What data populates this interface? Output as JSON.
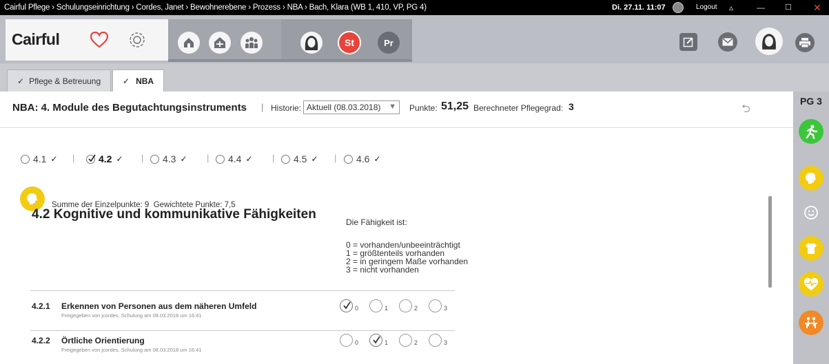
{
  "titlebar": {
    "title": "Cairful Pflege › Schulungseinrichtung › Cordes, Janet › Bewohnerebene › Prozess › NBA › Bach, Klara  (WB 1, 410, VP, PG 4)",
    "datetime": "Di. 27.11. 11:07",
    "logout_label": "Logout",
    "minimize_icon": "minimize-icon",
    "maximize_icon": "maximize-icon",
    "close_icon": "close-icon"
  },
  "toolbar": {
    "logo": "Cairful",
    "accent_color": "#e8443a",
    "icons": [
      "heart-icon",
      "gear-icon",
      "home-icon",
      "house-network-icon",
      "group-icon",
      "resident-avatar-icon",
      "st-badge-icon",
      "pr-badge-icon",
      "edit-icon",
      "mail-icon",
      "user-avatar-icon",
      "print-icon"
    ],
    "st_label": "St",
    "pr_label": "Pr"
  },
  "tabs": [
    {
      "label": "Pflege & Betreuung",
      "check": "✓",
      "active": false
    },
    {
      "label": "NBA",
      "check": "✓",
      "active": true
    }
  ],
  "header": {
    "title": "NBA: 4. Module des Begutachtungsinstruments",
    "separator": "|",
    "history_label": "Historie:",
    "history_value": "Aktuell (08.03.2018)",
    "points_label": "Punkte:",
    "points_value": "51,25",
    "grade_label": "Berechneter Pflegegrad:",
    "grade_value": "3"
  },
  "modules": [
    {
      "label": "4.1",
      "check": "✓",
      "selected": false
    },
    {
      "label": "4.2",
      "check": "✓",
      "selected": true
    },
    {
      "label": "4.3",
      "check": "✓",
      "selected": false
    },
    {
      "label": "4.4",
      "check": "✓",
      "selected": false
    },
    {
      "label": "4.5",
      "check": "✓",
      "selected": false
    },
    {
      "label": "4.6",
      "check": "✓",
      "selected": false
    }
  ],
  "summary": {
    "sum_label": "Summe der Einzelpunkte:",
    "sum_value": "9",
    "weighted_label": "Gewichtete Punkte:",
    "weighted_value": "7,5"
  },
  "section": {
    "title": "4.2 Kognitive und kommunikative Fähigkeiten",
    "legend_title": "Die Fähigkeit ist:",
    "legend": [
      "0 = vorhanden/unbeeinträchtigt",
      "1 = größtenteils vorhanden",
      "2 = in geringem Maße vorhanden",
      "3 = nicht vorhanden"
    ]
  },
  "items": [
    {
      "number": "4.2.1",
      "title": "Erkennen von Personen aus dem näheren Umfeld",
      "subtitle": "Freigegeben von jcordes, Schulung am 08.03.2018 um 16:41",
      "options": [
        "0",
        "1",
        "2",
        "3"
      ],
      "selected": 0
    },
    {
      "number": "4.2.2",
      "title": "Örtliche Orientierung",
      "subtitle": "Freigegeben von jcordes, Schulung am 08.03.2018 um 16:41",
      "options": [
        "0",
        "1",
        "2",
        "3"
      ],
      "selected": 1
    }
  ],
  "rail": {
    "pg_label": "PG 3",
    "icons": [
      {
        "name": "mobility-icon",
        "color": "#3cc63c"
      },
      {
        "name": "cognition-icon",
        "color": "#f2cc12"
      },
      {
        "name": "behavior-icon",
        "color": "#c4c6cb"
      },
      {
        "name": "selfcare-icon",
        "color": "#f2cc12"
      },
      {
        "name": "health-icon",
        "color": "#f2cc12"
      },
      {
        "name": "social-icon",
        "color": "#f08a28"
      }
    ]
  }
}
